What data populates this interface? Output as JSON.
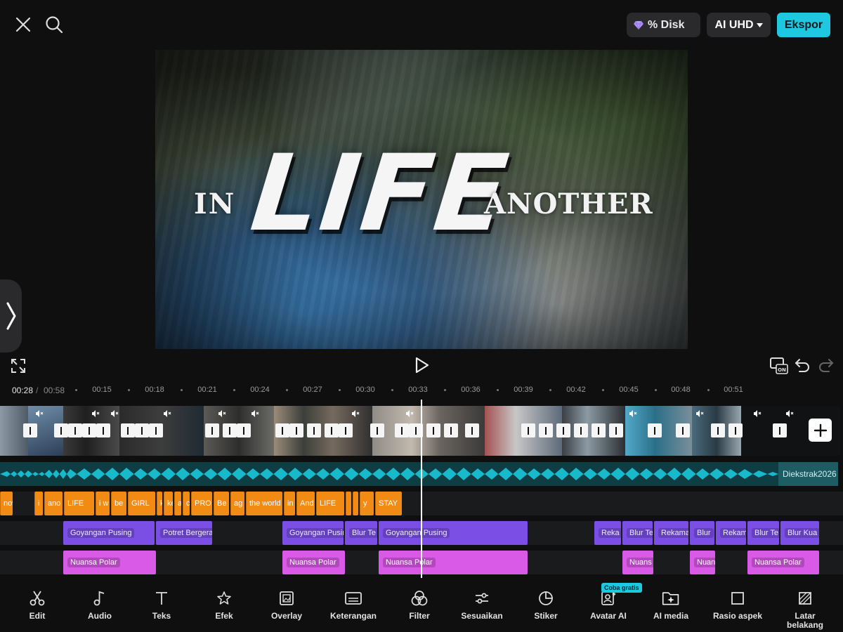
{
  "topbar": {
    "discount_label": "% Disk",
    "quality_label": "AI UHD",
    "export_label": "Ekspor"
  },
  "preview": {
    "title_in": "IN",
    "title_life": "LIFE",
    "title_another": "ANOTHER"
  },
  "timeline": {
    "current_time": "00:28",
    "separator": "/",
    "total_time": "00:58",
    "ticks": [
      "00:15",
      "00:18",
      "00:21",
      "00:24",
      "00:27",
      "00:30",
      "00:33",
      "00:36",
      "00:39",
      "00:42",
      "00:45",
      "00:48",
      "00:51"
    ]
  },
  "audio_track": {
    "label": "Diekstrak2026"
  },
  "text_clips": [
    "now",
    "i",
    "ano",
    "LIFE",
    "i w",
    "be",
    "GIRL",
    "k",
    "ke",
    "a",
    "c",
    "PRO",
    "Be",
    "ag",
    "the world",
    "in",
    "And",
    "LIFE",
    "",
    "",
    "y",
    "STAY"
  ],
  "effect_clips": [
    "Goyangan Pusing",
    "Potret Bergerak",
    "Goyangan Pusing",
    "Blur Te",
    "Goyangan Pusing",
    "Reka",
    "Blur Te",
    "Rekama",
    "Blur",
    "Rekam",
    "Blur Te",
    "Blur Kua"
  ],
  "filter_clips": [
    "Nuansa Polar",
    "Nuansa Polar",
    "Nuansa Polar",
    "Nuans",
    "Nuan",
    "Nuansa Polar"
  ],
  "toolbar": {
    "items": [
      "Edit",
      "Audio",
      "Teks",
      "Efek",
      "Overlay",
      "Keterangan",
      "Filter",
      "Sesuaikan",
      "Stiker",
      "Avatar AI",
      "AI media",
      "Rasio aspek",
      "Latar belakang"
    ],
    "badge": "Coba gratis"
  },
  "colors": {
    "accent": "#1ec8e0",
    "text_clip": "#f28b14",
    "effect_clip": "#7b4fe6",
    "filter_clip": "#d85ae6",
    "audio": "#19b9cc"
  }
}
